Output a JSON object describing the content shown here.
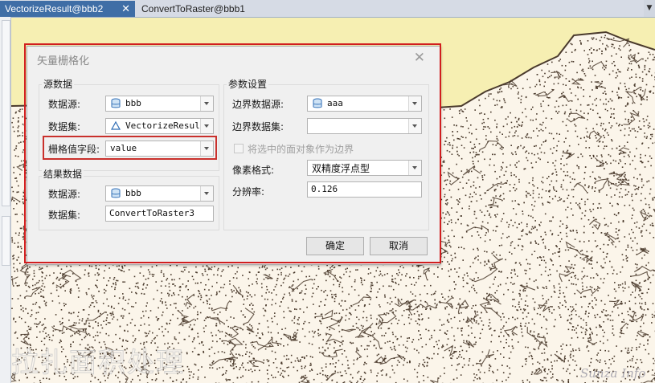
{
  "tabs": [
    {
      "label": "VectorizeResult@bbb2",
      "active": true
    },
    {
      "label": "ConvertToRaster@bbb1",
      "active": false
    }
  ],
  "colors": {
    "tab_active": "#3f6ea6",
    "map_fill": "#fbf5ea",
    "map_line": "#4a3a2c",
    "highlight": "#d11e1e",
    "sea": "#f6efb2"
  },
  "map": {
    "watermark": "拉扎面积处理",
    "logo": "Sunza Info"
  },
  "dialog": {
    "title": "矢量栅格化",
    "close_icon": "close-icon",
    "source": {
      "group_title": "源数据",
      "datasource_label": "数据源:",
      "datasource_value": "bbb",
      "datasource_icon": "database-icon",
      "dataset_label": "数据集:",
      "dataset_value": "VectorizeResult",
      "dataset_icon": "region-dataset-icon",
      "field_label": "栅格值字段:",
      "field_value": "value"
    },
    "result": {
      "group_title": "结果数据",
      "datasource_label": "数据源:",
      "datasource_value": "bbb",
      "datasource_icon": "database-icon",
      "dataset_label": "数据集:",
      "dataset_value": "ConvertToRaster3"
    },
    "params": {
      "group_title": "参数设置",
      "boundary_ds_label": "边界数据源:",
      "boundary_ds_value": "aaa",
      "boundary_ds_icon": "database-icon",
      "boundary_set_label": "边界数据集:",
      "boundary_set_value": "",
      "use_selected_label": "将选中的面对象作为边界",
      "use_selected_checked": false,
      "pixel_format_label": "像素格式:",
      "pixel_format_value": "双精度浮点型",
      "resolution_label": "分辨率:",
      "resolution_value": "0.126"
    },
    "ok_label": "确定",
    "cancel_label": "取消"
  }
}
